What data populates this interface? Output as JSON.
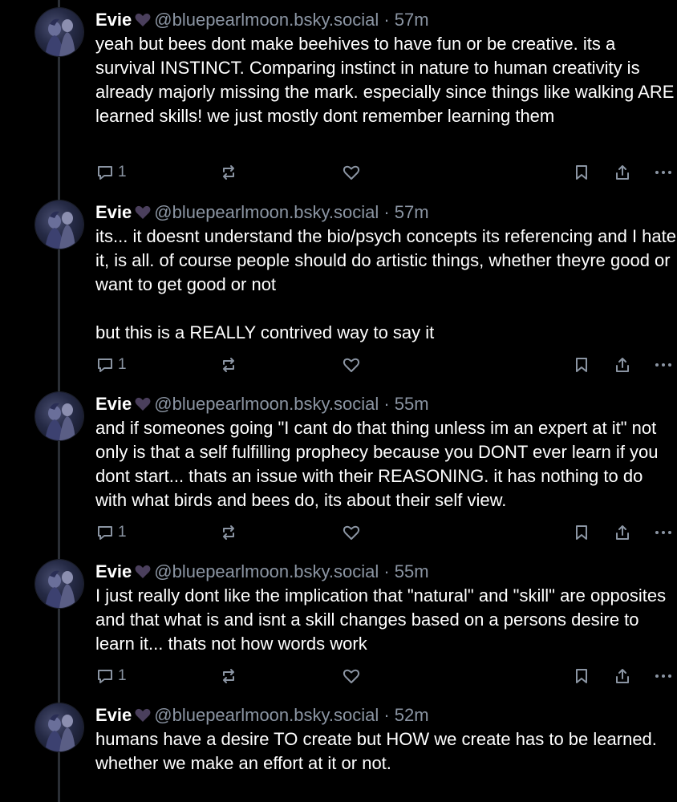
{
  "colors": {
    "background": "#000000",
    "text": "#ffffff",
    "muted": "#8b95a3",
    "heart": "#4a3f5c",
    "thread_line": "#2b2f36"
  },
  "posts": [
    {
      "author": "Evie",
      "handle": "@bluepearlmoon.bsky.social",
      "time": "57m",
      "text": "yeah but bees dont make beehives to have fun or be creative. its a survival INSTINCT. Comparing instinct in nature to human creativity is already majorly missing the mark. especially since things like walking ARE learned skills! we just mostly dont remember learning them",
      "reply_count": "1"
    },
    {
      "author": "Evie",
      "handle": "@bluepearlmoon.bsky.social",
      "time": "57m",
      "text": "its... it doesnt understand the bio/psych concepts its referencing and I hate it, is all. of course people should do artistic things, whether theyre good or want to get good or not\n\nbut this is a REALLY contrived way to say it",
      "reply_count": "1"
    },
    {
      "author": "Evie",
      "handle": "@bluepearlmoon.bsky.social",
      "time": "55m",
      "text": "and if someones going \"I cant do that thing unless im an expert at it\" not only is that a self fulfilling prophecy because you DONT ever learn if you dont start... thats an issue with their REASONING. it has nothing to do with what birds and bees do, its about their self view.",
      "reply_count": "1"
    },
    {
      "author": "Evie",
      "handle": "@bluepearlmoon.bsky.social",
      "time": "55m",
      "text": "I just really dont like the implication that \"natural\" and \"skill\" are opposites and that what is and isnt a skill changes based on a persons desire to learn it... thats not how words work",
      "reply_count": "1"
    },
    {
      "author": "Evie",
      "handle": "@bluepearlmoon.bsky.social",
      "time": "52m",
      "text": "humans have a desire TO create but HOW we create has to be learned. whether we make an effort at it or not."
    }
  ],
  "icons": {
    "reply": "speech-bubble-icon",
    "repost": "repost-arrows-icon",
    "like": "heart-outline-icon",
    "bookmark": "bookmark-icon",
    "share": "share-upload-icon",
    "more": "ellipsis-icon",
    "author_badge": "purple-heart-icon"
  }
}
